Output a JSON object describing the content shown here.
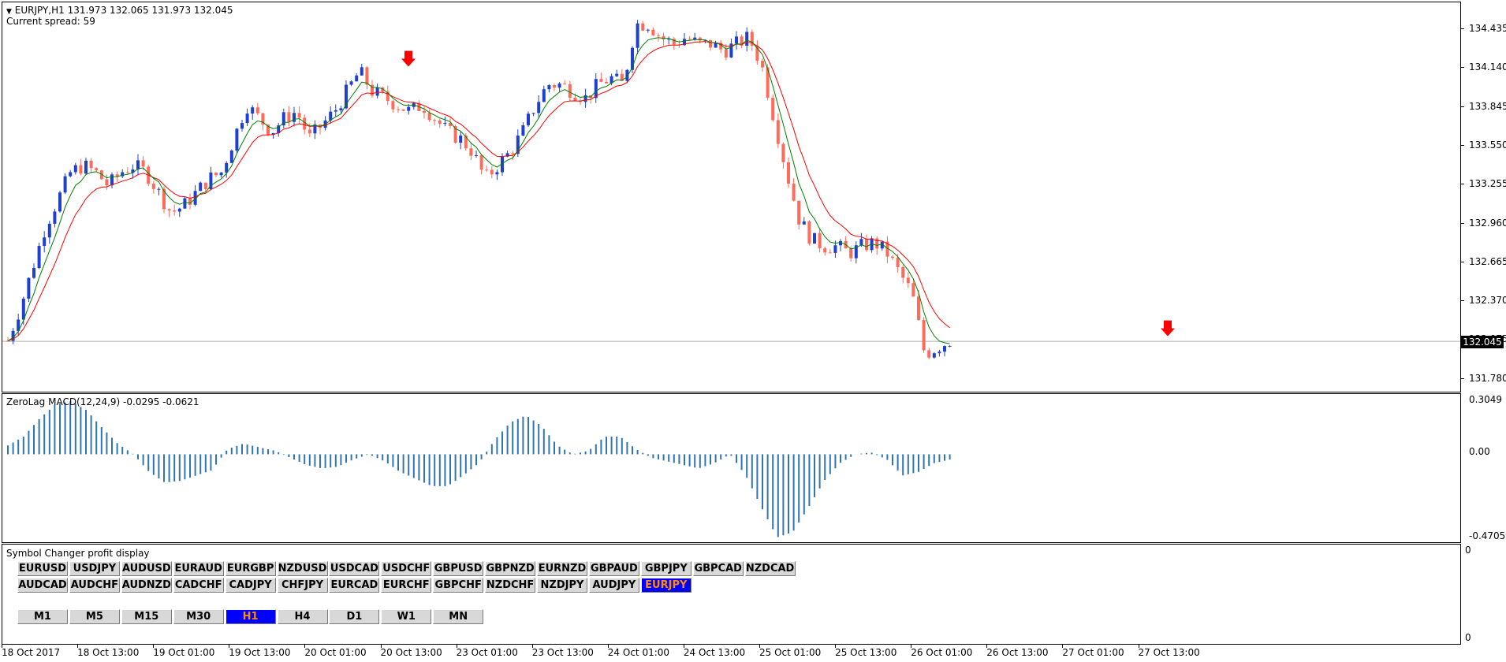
{
  "chart": {
    "title_line": "EURJPY,H1  131.973 132.065 131.973 132.045",
    "spread_label": "Current spread: 59",
    "current_price": "132.045",
    "price_axis_labels": [
      "134.435",
      "134.140",
      "133.845",
      "133.550",
      "133.255",
      "132.960",
      "132.665",
      "132.370",
      "132.075",
      "131.780"
    ],
    "time_axis_labels": [
      "18 Oct 2017",
      "18 Oct 13:00",
      "19 Oct 01:00",
      "19 Oct 13:00",
      "20 Oct 01:00",
      "20 Oct 13:00",
      "23 Oct 01:00",
      "23 Oct 13:00",
      "24 Oct 01:00",
      "24 Oct 13:00",
      "25 Oct 01:00",
      "25 Oct 13:00",
      "26 Oct 01:00",
      "26 Oct 13:00",
      "27 Oct 01:00",
      "27 Oct 13:00"
    ],
    "colors": {
      "bull": "#1f3fd0",
      "bear": "#ff6b5a",
      "fast_ma": "#008000",
      "slow_ma": "#ff0000",
      "arrow": "#ff0000",
      "macd": "#2f75b5"
    },
    "signal_arrows": [
      {
        "icon": "down-arrow-icon",
        "price": 134.13
      },
      {
        "icon": "down-arrow-icon",
        "price": 132.13
      }
    ]
  },
  "chart_data": {
    "type": "candlestick",
    "symbol": "EURJPY",
    "timeframe": "H1",
    "ylim": [
      131.66,
      134.56
    ],
    "close_path": [
      132.05,
      132.3,
      132.6,
      132.9,
      133.1,
      133.3,
      133.35,
      133.3,
      133.2,
      133.3,
      133.35,
      133.3,
      133.15,
      133.0,
      133.05,
      133.15,
      133.25,
      133.3,
      133.55,
      133.8,
      133.7,
      133.6,
      133.7,
      133.75,
      133.55,
      133.65,
      133.75,
      133.9,
      134.05,
      133.9,
      133.85,
      133.8,
      133.75,
      133.8,
      133.7,
      133.6,
      133.55,
      133.45,
      133.25,
      133.35,
      133.45,
      133.6,
      133.8,
      133.95,
      133.95,
      133.9,
      133.85,
      133.95,
      134.0,
      133.95,
      134.4,
      134.4,
      134.3,
      134.25,
      134.3,
      134.25,
      134.25,
      134.2,
      134.25,
      134.3,
      134.1,
      133.7,
      133.3,
      132.95,
      132.8,
      132.75,
      132.75,
      132.7,
      132.75,
      132.78,
      132.7,
      132.55,
      132.4,
      131.95,
      132.0,
      132.05
    ],
    "macd_label": "ZeroLag MACD(12,24,9) -0.0295 -0.0621",
    "macd_axis_labels": [
      "0.3049",
      "0.00",
      "-0.4705"
    ],
    "macd_range": [
      -0.4705,
      0.3049
    ],
    "macd_path": [
      0.05,
      0.1,
      0.2,
      0.28,
      0.3,
      0.25,
      0.15,
      0.06,
      0.0,
      -0.1,
      -0.16,
      -0.15,
      -0.12,
      -0.09,
      0.03,
      0.06,
      0.04,
      0.02,
      -0.02,
      -0.06,
      -0.08,
      -0.07,
      -0.03,
      0.0,
      -0.04,
      -0.1,
      -0.14,
      -0.18,
      -0.18,
      -0.12,
      -0.05,
      0.08,
      0.18,
      0.22,
      0.16,
      0.05,
      0.0,
      0.02,
      0.1,
      0.1,
      0.03,
      -0.02,
      -0.04,
      -0.06,
      -0.08,
      -0.05,
      0.0,
      -0.12,
      -0.3,
      -0.47,
      -0.44,
      -0.3,
      -0.15,
      -0.05,
      0.0,
      0.01,
      -0.03,
      -0.12,
      -0.1,
      -0.05,
      -0.03
    ]
  },
  "symbol_changer": {
    "title": "Symbol Changer profit display",
    "row1": [
      "EURUSD",
      "USDJPY",
      "AUDUSD",
      "EURAUD",
      "EURGBP",
      "NZDUSD",
      "USDCAD",
      "USDCHF",
      "GBPUSD",
      "GBPNZD",
      "EURNZD",
      "GBPAUD",
      "GBPJPY",
      "GBPCAD",
      "NZDCAD"
    ],
    "row2": [
      "AUDCAD",
      "AUDCHF",
      "AUDNZD",
      "CADCHF",
      "CADJPY",
      "CHFJPY",
      "EURCAD",
      "EURCHF",
      "GBPCHF",
      "NZDCHF",
      "NZDJPY",
      "AUDJPY",
      "EURJPY"
    ],
    "active_symbol": "EURJPY",
    "timeframes": [
      "M1",
      "M5",
      "M15",
      "M30",
      "H1",
      "H4",
      "D1",
      "W1",
      "MN"
    ],
    "active_timeframe": "H1",
    "axis_labels": [
      "0",
      "0"
    ]
  }
}
